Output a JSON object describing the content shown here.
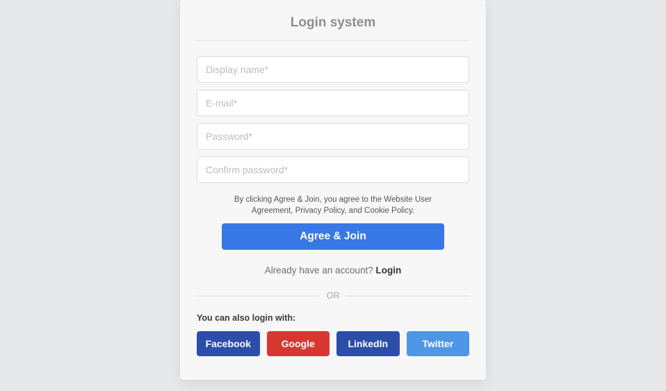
{
  "title": "Login system",
  "fields": {
    "displayName": {
      "placeholder": "Display name*"
    },
    "email": {
      "placeholder": "E-mail*"
    },
    "password": {
      "placeholder": "Password*"
    },
    "confirmPassword": {
      "placeholder": "Confirm password*"
    }
  },
  "terms": "By clicking Agree & Join, you agree to the Website User Agreement, Privacy Policy, and Cookie Policy.",
  "agreeButton": "Agree & Join",
  "already": {
    "text": "Already have an account? ",
    "link": "Login"
  },
  "or": "OR",
  "altLoginLabel": "You can also login with:",
  "social": {
    "facebook": "Facebook",
    "google": "Google",
    "linkedin": "LinkedIn",
    "twitter": "Twitter"
  }
}
